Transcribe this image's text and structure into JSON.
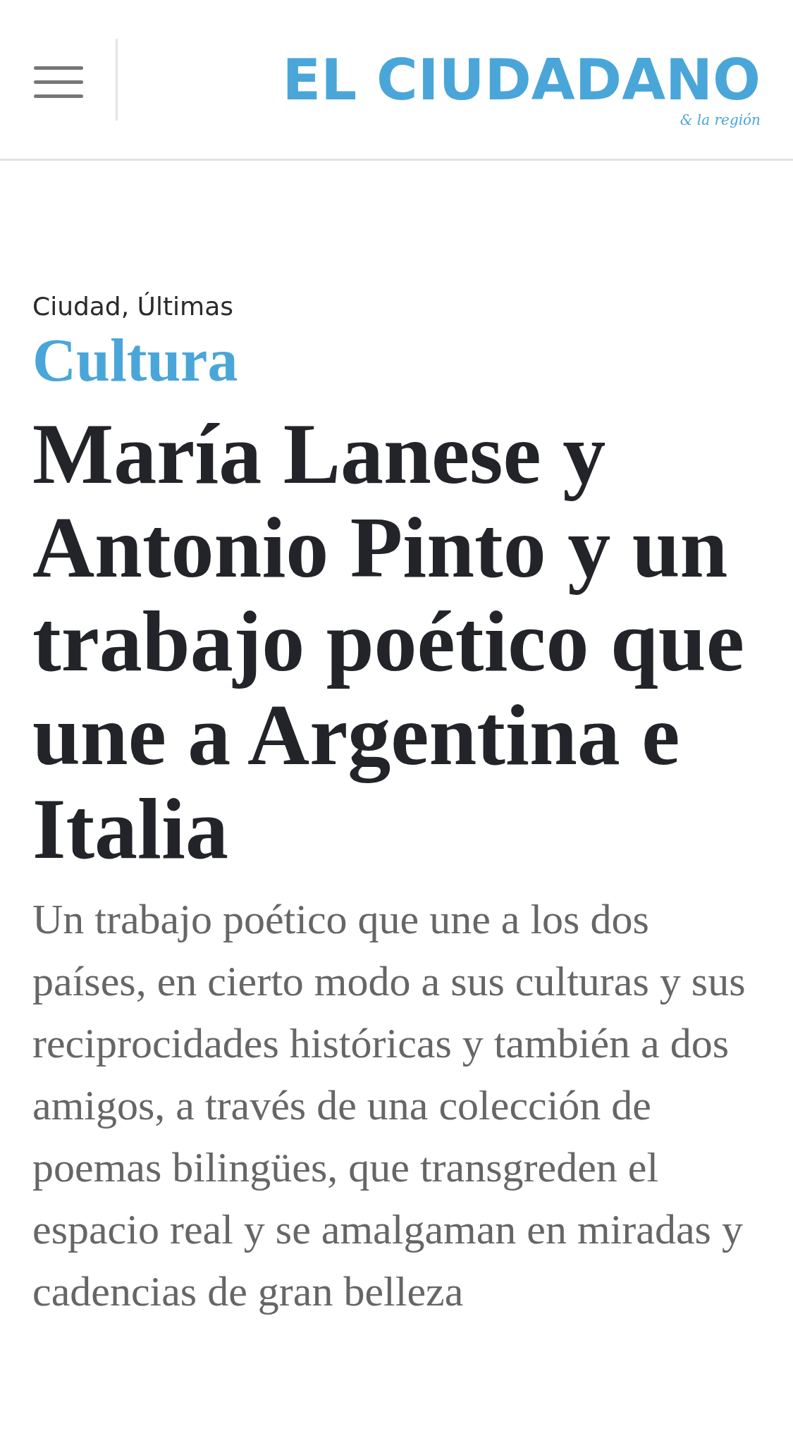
{
  "header": {
    "logo": "EL CIUDADANO",
    "logo_tagline": "& la región"
  },
  "article": {
    "categories": "Ciudad, Últimas",
    "section": "Cultura",
    "title": "María Lanese y Antonio Pinto y un trabajo poético que une a Argentina e Italia",
    "summary": "Un trabajo poético que une a los dos países, en cierto modo a sus culturas y sus reciprocidades históricas y también a dos amigos, a través de una colección de poemas bilingües, que transgreden el espacio real y se amalgaman en miradas y cadencias de gran belleza"
  }
}
